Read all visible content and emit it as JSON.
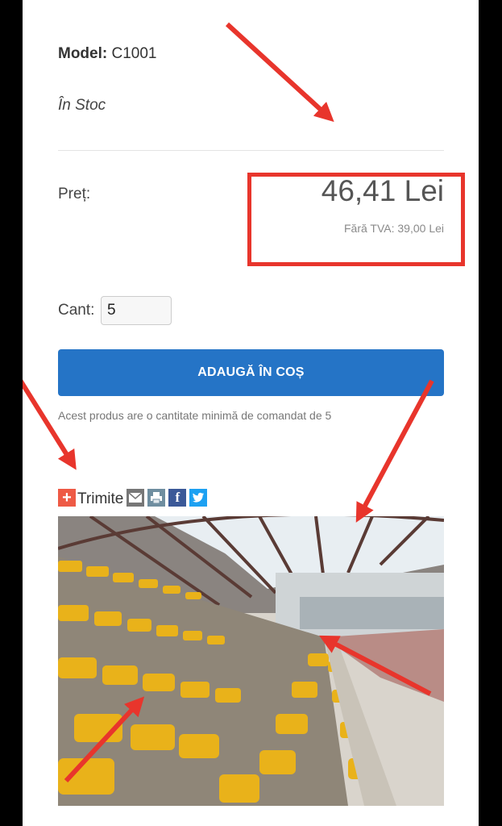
{
  "product": {
    "model_label": "Model:",
    "model_value": "C1001",
    "stock": "În Stoc",
    "price_label": "Preț:",
    "price": "46,41 Lei",
    "price_no_vat": "Fără TVA: 39,00 Lei",
    "qty_label": "Cant:",
    "qty_value": "5",
    "add_to_cart": "ADAUGĂ ÎN COȘ",
    "min_qty_note": "Acest produs are o cantitate minimă de comandat de 5"
  },
  "share": {
    "label": "Trimite",
    "icons": [
      "plus-icon",
      "email-icon",
      "print-icon",
      "facebook-icon",
      "twitter-icon"
    ]
  },
  "colors": {
    "button": "#2574c6",
    "annotation": "#e8352c",
    "facebook": "#3b5998",
    "twitter": "#1da1f2"
  }
}
